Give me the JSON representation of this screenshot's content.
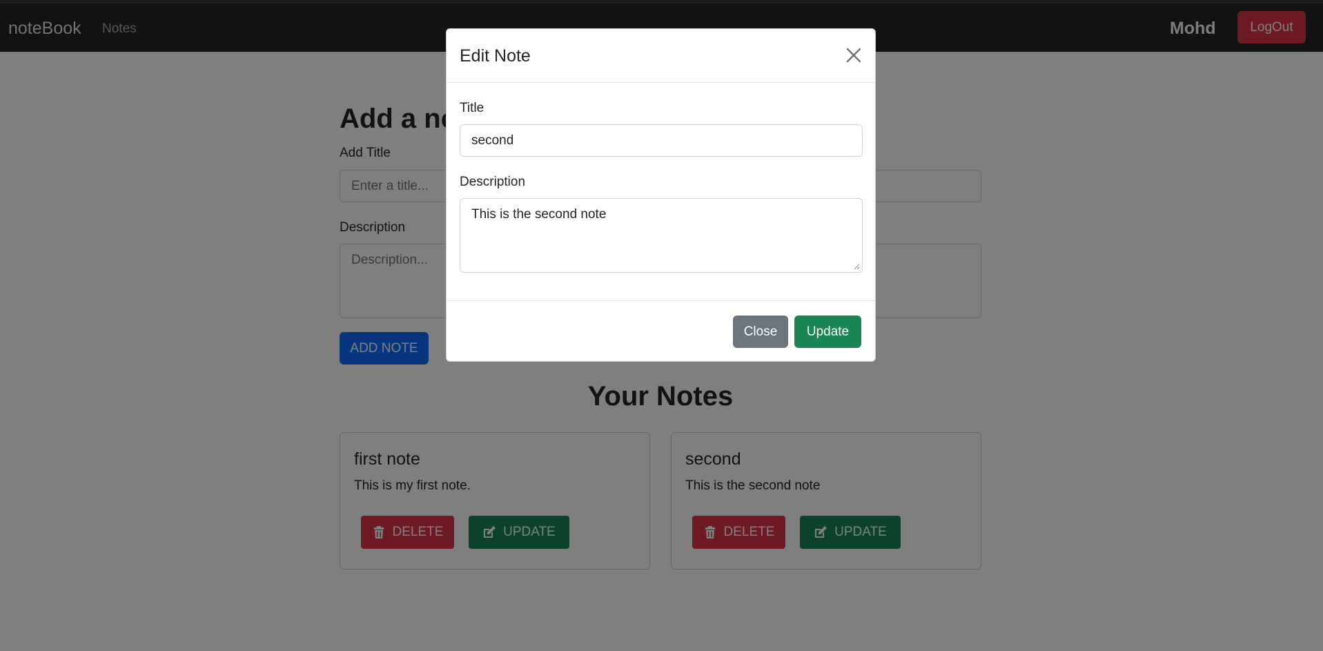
{
  "navbar": {
    "brand": "noteBook",
    "link_notes": "Notes",
    "username": "Mohd",
    "logout_label": "LogOut"
  },
  "add_note": {
    "heading": "Add a note",
    "title_label": "Add Title",
    "title_placeholder": "Enter a title...",
    "description_label": "Description",
    "description_placeholder": "Description...",
    "add_button": "ADD NOTE"
  },
  "notes": {
    "heading": "Your Notes",
    "items": [
      {
        "title": "first note",
        "description": "This is my first note.",
        "delete_label": "DELETE",
        "update_label": "UPDATE"
      },
      {
        "title": "second",
        "description": "This is the second note",
        "delete_label": "DELETE",
        "update_label": "UPDATE"
      }
    ]
  },
  "modal": {
    "title": "Edit Note",
    "title_label": "Title",
    "title_value": "second",
    "description_label": "Description",
    "description_value": "This is the second note",
    "close_label": "Close",
    "update_label": "Update"
  },
  "colors": {
    "navbar": "#212529",
    "danger": "#dc3545",
    "success": "#198754",
    "primary": "#0d6efd",
    "secondary": "#6c757d"
  },
  "icons": {
    "close": "close-icon",
    "delete": "trash-icon",
    "update": "edit-icon"
  }
}
